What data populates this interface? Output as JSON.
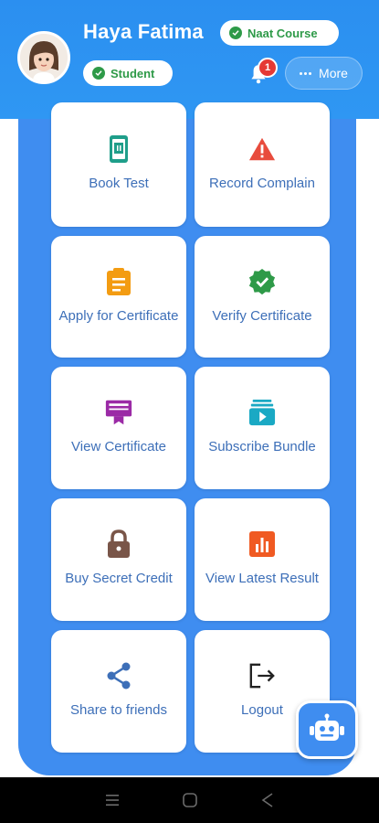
{
  "user": {
    "name": "Haya Fatima",
    "course_badge": "Naat Course",
    "role_badge": "Student"
  },
  "header": {
    "notification_count": "1",
    "more_label": "More"
  },
  "tiles": [
    {
      "label": "Book Test",
      "icon": "test-card-icon",
      "color": "#1f9e8a"
    },
    {
      "label": "Record Complain",
      "icon": "warning-icon",
      "color": "#e84c3d"
    },
    {
      "label": "Apply for Certificate",
      "icon": "clipboard-icon",
      "color": "#f39c12"
    },
    {
      "label": "Verify Certificate",
      "icon": "verified-badge-icon",
      "color": "#2e9a48"
    },
    {
      "label": "View Certificate",
      "icon": "certificate-icon",
      "color": "#9b2aa6"
    },
    {
      "label": "Subscribe Bundle",
      "icon": "video-bundle-icon",
      "color": "#1aa9c4"
    },
    {
      "label": "Buy Secret Credit",
      "icon": "lock-icon",
      "color": "#795548"
    },
    {
      "label": "View Latest Result",
      "icon": "bar-chart-icon",
      "color": "#f05a22"
    },
    {
      "label": "Share to friends",
      "icon": "share-icon",
      "color": "#3d6fb8"
    },
    {
      "label": "Logout",
      "icon": "logout-icon",
      "color": "#222222"
    }
  ],
  "colors": {
    "header": "#2f97f3",
    "panel": "#3f8df0",
    "tile_text": "#3d6fb8",
    "badge_green": "#2e9a48"
  }
}
